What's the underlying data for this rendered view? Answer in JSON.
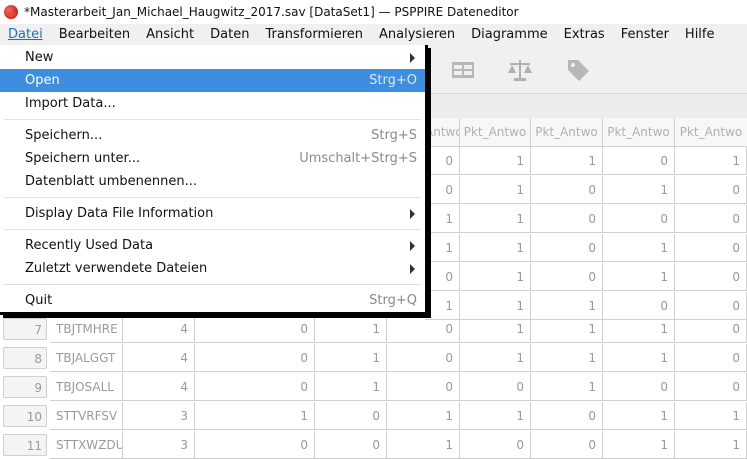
{
  "window": {
    "title": "*Masterarbeit_Jan_Michael_Haugwitz_2017.sav [DataSet1] — PSPPIRE Dateneditor"
  },
  "menubar": [
    "Datei",
    "Bearbeiten",
    "Ansicht",
    "Daten",
    "Transformieren",
    "Analysieren",
    "Diagramme",
    "Extras",
    "Fenster",
    "Hilfe"
  ],
  "toolbar": {
    "icons": [
      "split-file-icon",
      "weight-cases-icon",
      "value-labels-icon"
    ]
  },
  "file_menu": {
    "items": [
      {
        "label": "New",
        "accel": "",
        "submenu": true
      },
      {
        "label": "Open",
        "accel": "Strg+O",
        "submenu": false,
        "selected": true
      },
      {
        "label": "Import Data...",
        "accel": "",
        "submenu": false
      },
      {
        "label": "Speichern...",
        "accel": "Strg+S",
        "submenu": false
      },
      {
        "label": "Speichern unter...",
        "accel": "Umschalt+Strg+S",
        "submenu": false
      },
      {
        "label": "Datenblatt umbenennen...",
        "accel": "",
        "submenu": false
      },
      {
        "label": "Display Data File Information",
        "accel": "",
        "submenu": true
      },
      {
        "label": "Recently Used Data",
        "accel": "",
        "submenu": true
      },
      {
        "label": "Zuletzt verwendete Dateien",
        "accel": "",
        "submenu": true
      },
      {
        "label": "Quit",
        "accel": "Strg+Q",
        "submenu": false
      }
    ]
  },
  "grid": {
    "visible_headers": [
      "Antwo",
      "Pkt_Antwo",
      "Pkt_Antwo",
      "Pkt_Antwo",
      "Pkt_Antwo"
    ],
    "upper_rows": [
      [
        "0",
        "1",
        "1",
        "0",
        "1"
      ],
      [
        "0",
        "1",
        "0",
        "1",
        "0"
      ],
      [
        "1",
        "1",
        "0",
        "0",
        "0"
      ],
      [
        "1",
        "1",
        "0",
        "1",
        "0"
      ],
      [
        "0",
        "1",
        "0",
        "1",
        "0"
      ],
      [
        "1",
        "1",
        "1",
        "0",
        "0"
      ]
    ],
    "lower_rows": [
      {
        "num": "7",
        "name": "TBJTMHRE",
        "c1": "4",
        "c2": "0",
        "c3": "1",
        "cells": [
          "0",
          "1",
          "1",
          "1",
          "0"
        ]
      },
      {
        "num": "8",
        "name": "TBJALGGT",
        "c1": "4",
        "c2": "0",
        "c3": "1",
        "cells": [
          "0",
          "1",
          "1",
          "1",
          "0"
        ]
      },
      {
        "num": "9",
        "name": "TBJOSALL",
        "c1": "4",
        "c2": "0",
        "c3": "1",
        "cells": [
          "0",
          "0",
          "1",
          "0",
          "0"
        ]
      },
      {
        "num": "10",
        "name": "STTVRFSV",
        "c1": "3",
        "c2": "1",
        "c3": "0",
        "cells": [
          "1",
          "1",
          "0",
          "1",
          "1"
        ]
      },
      {
        "num": "11",
        "name": "STTXWZDU",
        "c1": "3",
        "c2": "0",
        "c3": "0",
        "cells": [
          "1",
          "0",
          "0",
          "1",
          "1"
        ]
      }
    ]
  }
}
